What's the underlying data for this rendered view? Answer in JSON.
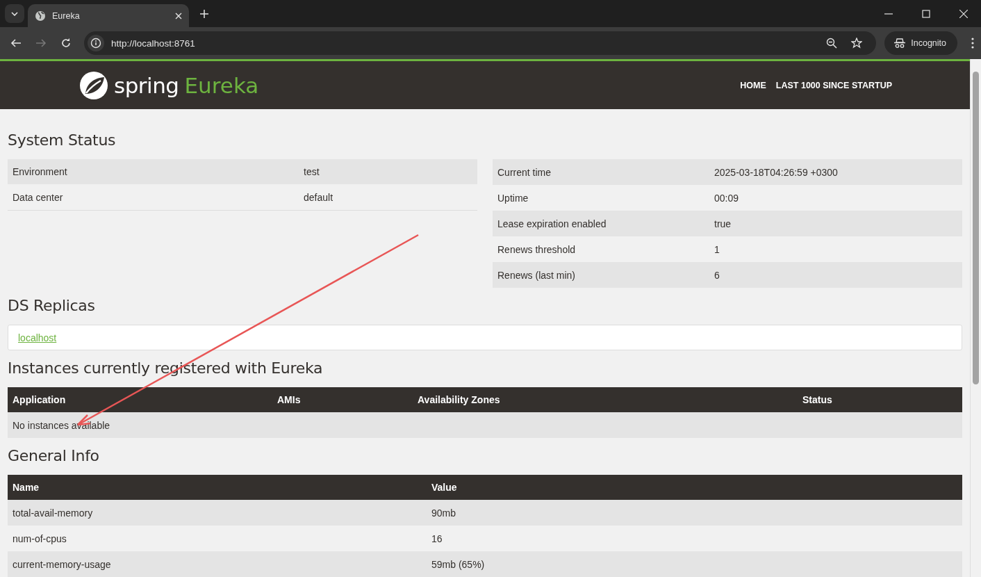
{
  "browser": {
    "tab_title": "Eureka",
    "url": "http://localhost:8761",
    "profile": "Incognito"
  },
  "header": {
    "logo_word": "spring",
    "logo_product": "Eureka",
    "nav": [
      "HOME",
      "LAST 1000 SINCE STARTUP"
    ]
  },
  "system_status": {
    "title": "System Status",
    "left_rows": [
      {
        "label": "Environment",
        "value": "test"
      },
      {
        "label": "Data center",
        "value": "default"
      }
    ],
    "right_rows": [
      {
        "label": "Current time",
        "value": "2025-03-18T04:26:59 +0300"
      },
      {
        "label": "Uptime",
        "value": "00:09"
      },
      {
        "label": "Lease expiration enabled",
        "value": "true"
      },
      {
        "label": "Renews threshold",
        "value": "1"
      },
      {
        "label": "Renews (last min)",
        "value": "6"
      }
    ]
  },
  "ds_replicas": {
    "title": "DS Replicas",
    "links": [
      "localhost"
    ]
  },
  "instances": {
    "title": "Instances currently registered with Eureka",
    "columns": [
      "Application",
      "AMIs",
      "Availability Zones",
      "Status"
    ],
    "empty_message": "No instances available"
  },
  "general_info": {
    "title": "General Info",
    "columns": [
      "Name",
      "Value"
    ],
    "rows": [
      {
        "name": "total-avail-memory",
        "value": "90mb"
      },
      {
        "name": "num-of-cpus",
        "value": "16"
      },
      {
        "name": "current-memory-usage",
        "value": "59mb (65%)"
      }
    ]
  }
}
